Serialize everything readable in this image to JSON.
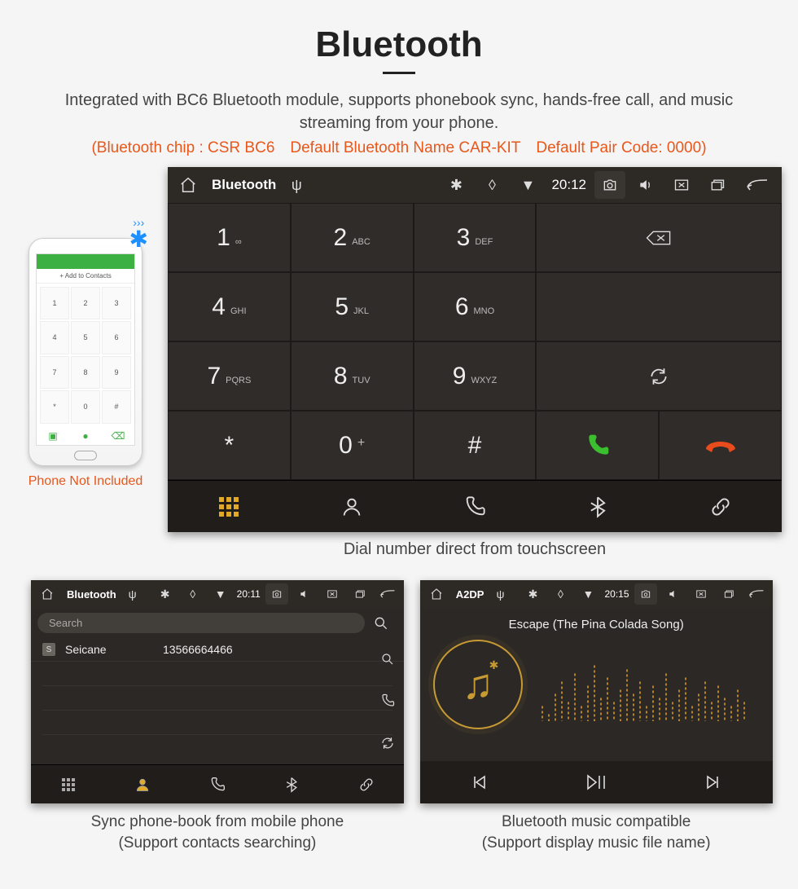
{
  "header": {
    "title": "Bluetooth",
    "subtitle": "Integrated with BC6 Bluetooth module, supports phonebook sync, hands-free call, and music streaming from your phone.",
    "spec_line": "(Bluetooth chip : CSR BC6 Default Bluetooth Name CAR-KIT Default Pair Code: 0000)"
  },
  "phone": {
    "add_contacts": "+ Add to Contacts",
    "keys": [
      "1",
      "2",
      "3",
      "4",
      "5",
      "6",
      "7",
      "8",
      "9",
      "*",
      "0",
      "#"
    ],
    "not_included": "Phone Not Included"
  },
  "main_unit": {
    "topbar_title": "Bluetooth",
    "time": "20:12",
    "keys": [
      {
        "d": "1",
        "l": "∞"
      },
      {
        "d": "2",
        "l": "ABC"
      },
      {
        "d": "3",
        "l": "DEF"
      },
      {
        "d": "4",
        "l": "GHI"
      },
      {
        "d": "5",
        "l": "JKL"
      },
      {
        "d": "6",
        "l": "MNO"
      },
      {
        "d": "7",
        "l": "PQRS"
      },
      {
        "d": "8",
        "l": "TUV"
      },
      {
        "d": "9",
        "l": "WXYZ"
      },
      {
        "d": "*",
        "l": ""
      },
      {
        "d": "0",
        "l": "+",
        "plus": true
      },
      {
        "d": "#",
        "l": ""
      }
    ],
    "caption": "Dial number direct from touchscreen"
  },
  "contacts_unit": {
    "topbar_title": "Bluetooth",
    "time": "20:11",
    "search_placeholder": "Search",
    "contact_name": "Seicane",
    "contact_badge": "S",
    "contact_number": "13566664466",
    "caption_line1": "Sync phone-book from mobile phone",
    "caption_line2": "(Support contacts searching)"
  },
  "music_unit": {
    "topbar_title": "A2DP",
    "time": "20:15",
    "song_title": "Escape (The Pina Colada Song)",
    "caption_line1": "Bluetooth music compatible",
    "caption_line2": "(Support display music file name)"
  }
}
